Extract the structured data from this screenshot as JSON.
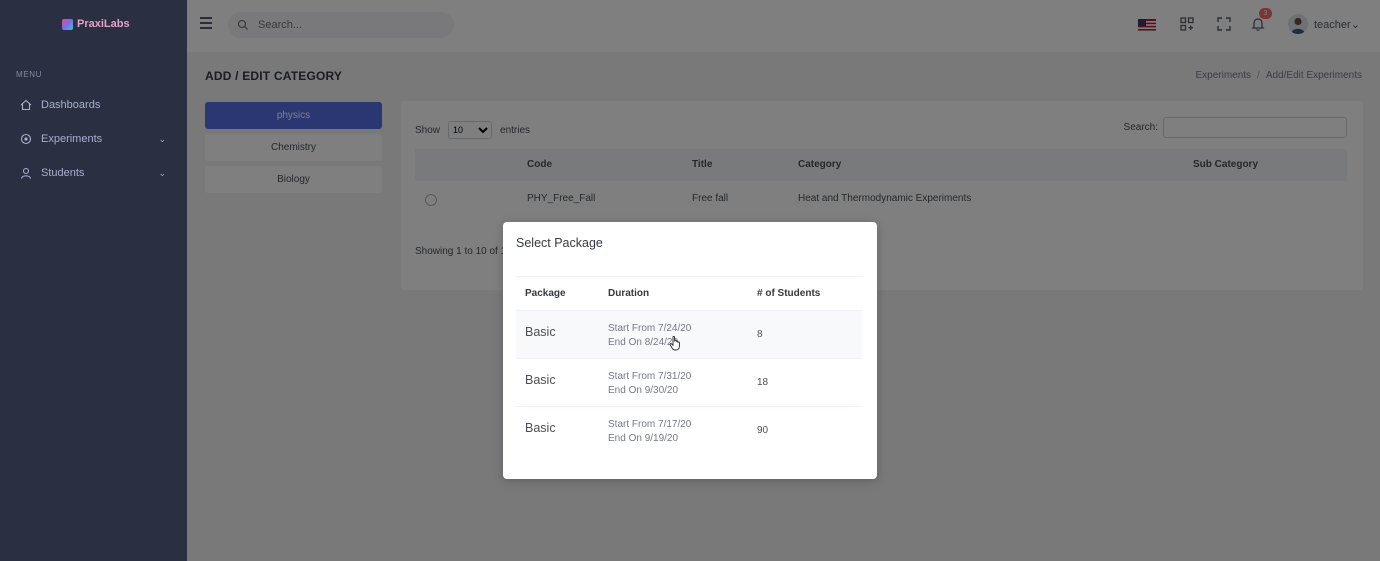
{
  "brand": {
    "name": "PraxiLabs"
  },
  "sidebar": {
    "menu_title": "MENU",
    "items": [
      {
        "label": "Dashboards",
        "icon": "home-icon"
      },
      {
        "label": "Experiments",
        "icon": "flask-icon",
        "chevron": "⌄"
      },
      {
        "label": "Students",
        "icon": "user-icon",
        "chevron": "⌄"
      }
    ]
  },
  "topbar": {
    "search_placeholder": "Search...",
    "notification_count": "3",
    "username": "teacher",
    "user_chevron": "⌄"
  },
  "page": {
    "title": "ADD / EDIT CATEGORY",
    "breadcrumb": {
      "item1": "Experiments",
      "sep": "/",
      "item2": "Add/Edit Experiments"
    }
  },
  "categories": [
    {
      "label": "physics",
      "active": true
    },
    {
      "label": "Chemistry",
      "active": false
    },
    {
      "label": "Biology",
      "active": false
    }
  ],
  "table": {
    "show_label": "Show",
    "entries_value": "10",
    "entries_label": "entries",
    "search_label": "Search:",
    "columns": {
      "code": "Code",
      "title": "Title",
      "category": "Category",
      "sub_category": "Sub Category"
    },
    "rows": [
      {
        "code": "PHY_Free_Fall",
        "title": "Free fall",
        "category": "Heat and Thermodynamic Experiments",
        "sub_category": ""
      }
    ],
    "info": "Showing 1 to 10 of 1"
  },
  "modal": {
    "title": "Select Package",
    "columns": {
      "package": "Package",
      "duration": "Duration",
      "students": "# of Students"
    },
    "rows": [
      {
        "package": "Basic",
        "start": "Start From 7/24/20",
        "end": "End On 8/24/20",
        "students": "8"
      },
      {
        "package": "Basic",
        "start": "Start From 7/31/20",
        "end": "End On 9/30/20",
        "students": "18"
      },
      {
        "package": "Basic",
        "start": "Start From 7/17/20",
        "end": "End On 9/19/20",
        "students": "90"
      }
    ]
  },
  "colors": {
    "sidebar": "#2a3042",
    "accent": "#556ee6",
    "badge": "#f46a6a"
  }
}
